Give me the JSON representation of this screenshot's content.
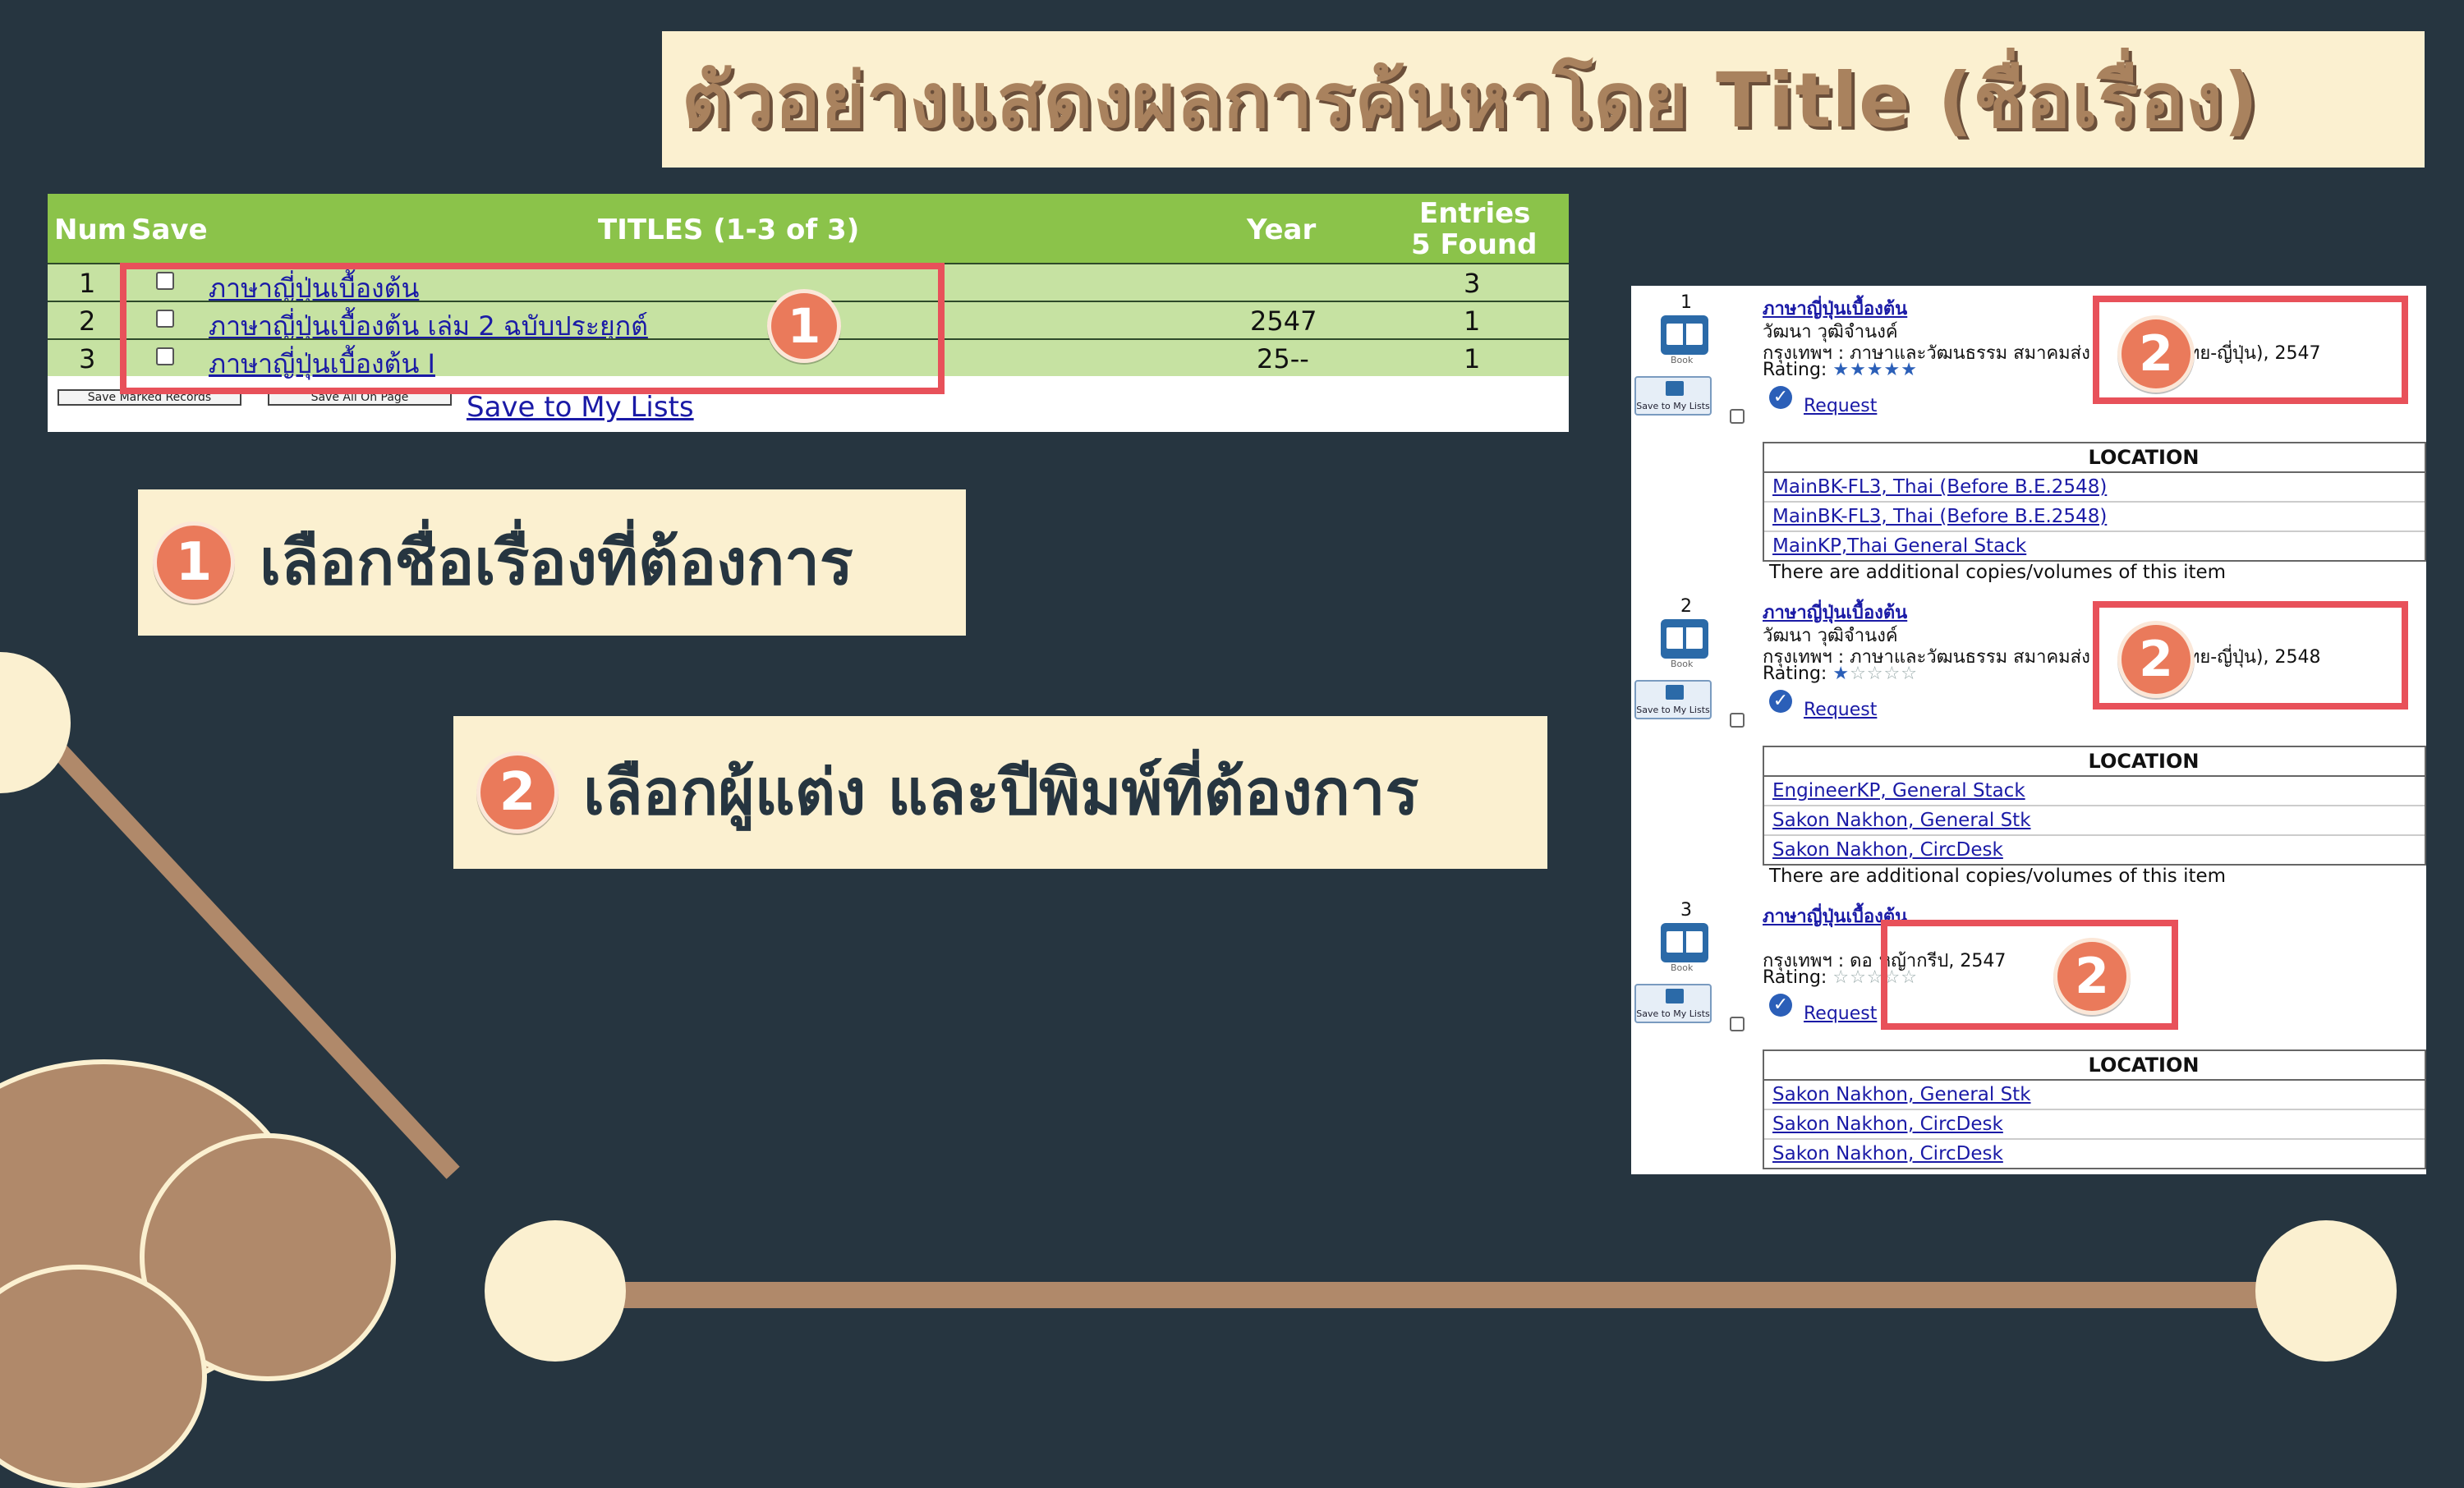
{
  "slide_title": "ตัวอย่างแสดงผลการค้นหาโดย Title (ชื่อเรื่อง)",
  "results_table": {
    "headers": {
      "num": "Num",
      "save": "Save",
      "titles": "TITLES (1-3 of 3)",
      "year": "Year",
      "entries_line1": "Entries",
      "entries_line2": "5 Found"
    },
    "rows": [
      {
        "num": "1",
        "title": "ภาษาญี่ปุ่นเบื้องต้น",
        "year": "",
        "entries": "3"
      },
      {
        "num": "2",
        "title": "ภาษาญี่ปุ่นเบื้องต้น เล่ม 2 ฉบับประยุกต์",
        "year": "2547",
        "entries": "1"
      },
      {
        "num": "3",
        "title": "ภาษาญี่ปุ่นเบื้องต้น I",
        "year": "25--",
        "entries": "1"
      }
    ],
    "buttons": {
      "save_marked": "Save Marked Records",
      "save_all": "Save All On Page",
      "save_lists": "Save to My Lists"
    }
  },
  "callouts": {
    "one_number": "1",
    "one_text": "เลือกชื่อเรื่องที่ต้องการ",
    "two_number": "2",
    "two_text": "เลือกผู้แต่ง และปีพิมพ์ที่ต้องการ"
  },
  "detail_records": [
    {
      "num": "1",
      "title": "ภาษาญี่ปุ่นเบื้องต้น",
      "author": "วัฒนา วุฒิจำนงค์",
      "publisher_start": "กรุงเทพฯ : ภาษาและวัฒนธรรม สมาคมส่ง",
      "publisher_end": "ลัย (ไทย-ญี่ปุ่น), 2547",
      "rating_label": "Rating:",
      "rating": 5,
      "request": "Request",
      "location_header": "LOCATION",
      "locations": [
        "MainBK-FL3, Thai (Before B.E.2548)",
        "MainBK-FL3, Thai (Before B.E.2548)",
        "MainKP,Thai General Stack"
      ],
      "note": "There are additional copies/volumes of this item"
    },
    {
      "num": "2",
      "title": "ภาษาญี่ปุ่นเบื้องต้น",
      "author": "วัฒนา วุฒิจำนงค์",
      "publisher_start": "กรุงเทพฯ : ภาษาและวัฒนธรรม สมาคมส่ง",
      "publisher_end": "ลัย (ไทย-ญี่ปุ่น), 2548",
      "rating_label": "Rating:",
      "rating": 1,
      "request": "Request",
      "location_header": "LOCATION",
      "locations": [
        "EngineerKP, General Stack",
        "Sakon Nakhon, General Stk",
        "Sakon Nakhon, CircDesk"
      ],
      "note": "There are additional copies/volumes of this item"
    },
    {
      "num": "3",
      "title": "ภาษาญี่ปุ่นเบื้องต้น",
      "author": "",
      "publisher_start": "กรุงเทพฯ : ดอ",
      "publisher_end": "หญ้ากรีป, 2547",
      "rating_label": "Rating:",
      "rating": 0,
      "request": "Request",
      "location_header": "LOCATION",
      "locations": [
        "Sakon Nakhon, General Stk",
        "Sakon Nakhon, CircDesk",
        "Sakon Nakhon, CircDesk"
      ],
      "note": ""
    }
  ],
  "icons": {
    "book": "book-icon",
    "book_label": "Book",
    "save_list": "save-to-list-icon",
    "save_list_label": "Save to My Lists",
    "request": "check-icon",
    "star_filled": "★",
    "star_empty": "☆"
  },
  "colors": {
    "background": "#263540",
    "banner": "#fbf0d0",
    "title_text": "#a9825e",
    "table_header": "#8bc34a",
    "table_row": "#c6e2a2",
    "highlight_box": "#e8515a",
    "number_badge": "#ea7a5b",
    "decor": "#b0896a"
  }
}
